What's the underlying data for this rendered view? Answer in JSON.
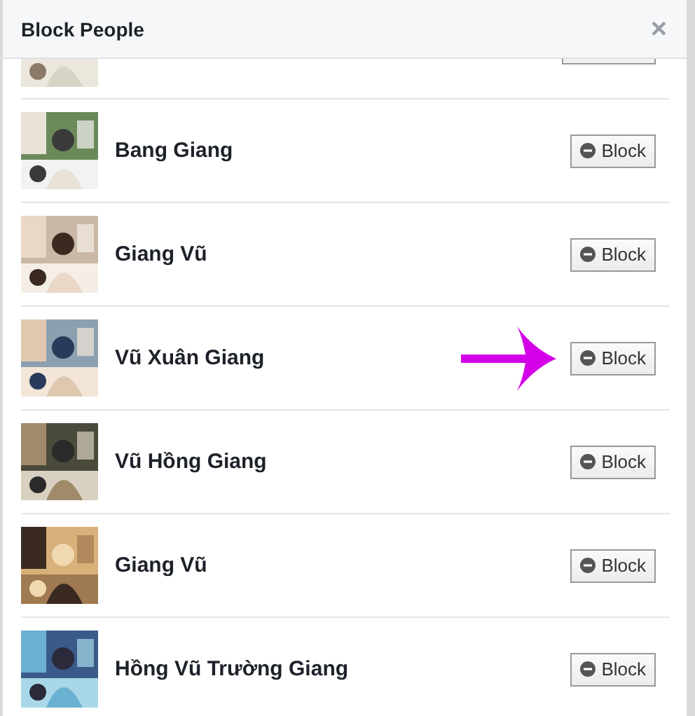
{
  "dialog": {
    "title": "Block People",
    "close": "×"
  },
  "rows": [
    {
      "kind": "partial"
    },
    {
      "kind": "person",
      "name": "Bang Giang",
      "button": "Block",
      "pointer": false
    },
    {
      "kind": "person",
      "name": "Giang Vũ",
      "button": "Block",
      "pointer": false
    },
    {
      "kind": "person",
      "name": "Vũ Xuân Giang",
      "button": "Block",
      "pointer": true
    },
    {
      "kind": "person",
      "name": "Vũ Hồng Giang",
      "button": "Block",
      "pointer": false
    },
    {
      "kind": "person",
      "name": "Giang Vũ",
      "button": "Block",
      "pointer": false
    },
    {
      "kind": "person",
      "name": "Hồng Vũ Trường Giang",
      "button": "Block",
      "pointer": false
    }
  ]
}
